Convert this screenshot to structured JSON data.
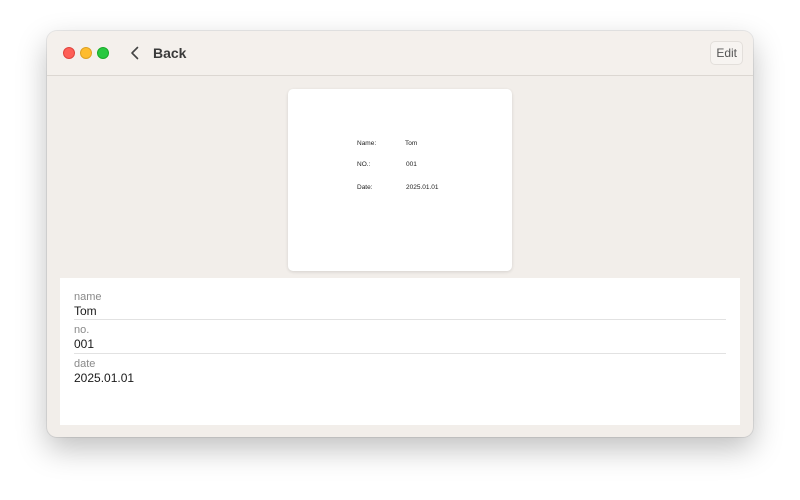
{
  "window": {
    "back_label": "Back",
    "edit_label": "Edit"
  },
  "preview": {
    "rows": [
      {
        "key": "Name:",
        "value": "Tom"
      },
      {
        "key": "NO.:",
        "value": "001"
      },
      {
        "key": "Date:",
        "value": "2025.01.01"
      }
    ]
  },
  "form": {
    "fields": [
      {
        "label": "name",
        "value": "Tom"
      },
      {
        "label": "no.",
        "value": "001"
      },
      {
        "label": "date",
        "value": "2025.01.01"
      }
    ]
  },
  "colors": {
    "close": "#fe5f57",
    "minimize": "#febc2e",
    "zoom": "#28c840",
    "window_bg": "#f2eeea"
  },
  "icons": {
    "back": "chevron-left-icon"
  }
}
